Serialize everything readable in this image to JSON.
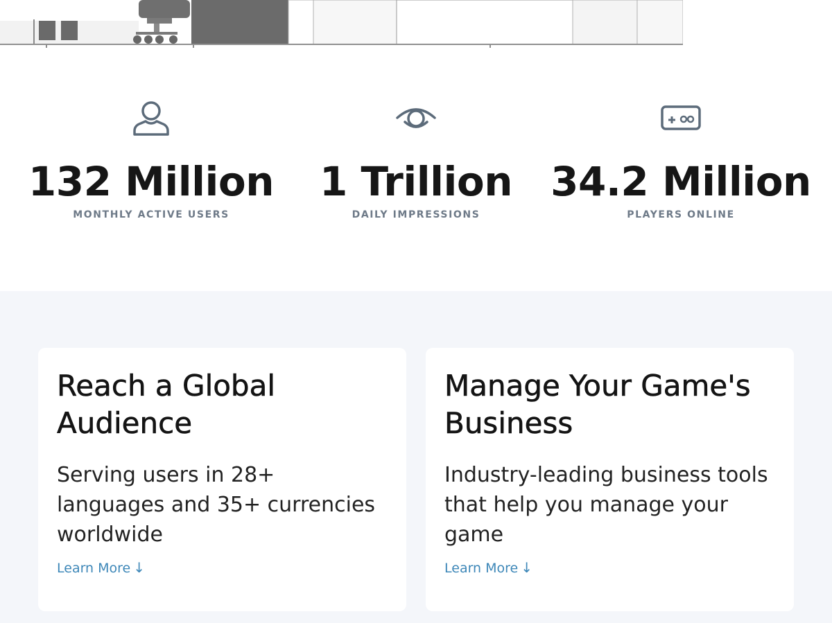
{
  "colors": {
    "accent_link": "#3d87b8",
    "label_gray": "#6e7a88",
    "icon_gray": "#5c6b7a",
    "section_bg": "#f4f6fa"
  },
  "stats": [
    {
      "icon": "person-icon",
      "value": "132 Million",
      "label": "MONTHLY ACTIVE USERS"
    },
    {
      "icon": "eye-icon",
      "value": "1 Trillion",
      "label": "DAILY IMPRESSIONS"
    },
    {
      "icon": "gamepad-icon",
      "value": "34.2 Million",
      "label": "PLAYERS ONLINE"
    }
  ],
  "cards": [
    {
      "title": "Reach a Global Audience",
      "description": "Serving users in 28+ languages and 35+ currencies worldwide",
      "link": "Learn More",
      "link_icon": "arrow-down-icon"
    },
    {
      "title": "Manage Your Game's Business",
      "description": "Industry-leading business tools that help you manage your game",
      "link": "Learn More",
      "link_icon": "arrow-down-icon"
    }
  ]
}
